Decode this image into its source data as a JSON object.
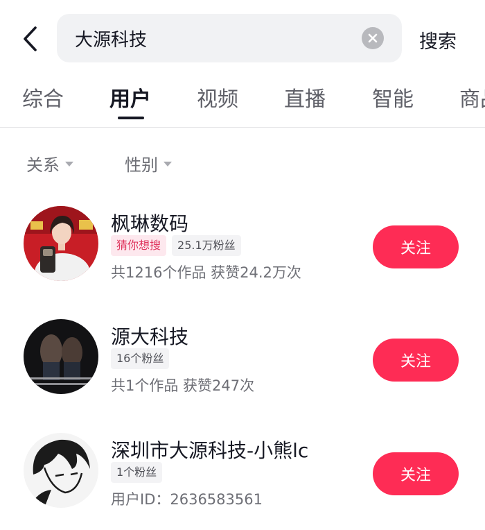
{
  "search": {
    "query": "大源科技",
    "button_label": "搜索"
  },
  "tabs": [
    {
      "label": "综合"
    },
    {
      "label": "用户"
    },
    {
      "label": "视频"
    },
    {
      "label": "直播"
    },
    {
      "label": "智能"
    },
    {
      "label": "商品"
    }
  ],
  "active_tab": "用户",
  "filters": [
    {
      "label": "关系"
    },
    {
      "label": "性别"
    }
  ],
  "users": [
    {
      "name": "枫琳数码",
      "tags": [
        {
          "label": "猜你想搜"
        },
        {
          "label": "25.1万粉丝"
        }
      ],
      "meta": "共1216个作品 获赞24.2万次",
      "follow_label": "关注"
    },
    {
      "name": "源大科技",
      "tags": [
        {
          "label": "16个粉丝"
        }
      ],
      "meta": "共1个作品 获赞247次",
      "follow_label": "关注"
    },
    {
      "name": "深圳市大源科技-小熊lc",
      "tags": [
        {
          "label": "1个粉丝"
        }
      ],
      "meta": "用户ID：2636583561",
      "follow_label": "关注"
    }
  ],
  "colors": {
    "accent": "#fe2c55",
    "text_primary": "#161823",
    "text_secondary": "#6e6f76",
    "tag_pink_text": "#e0365f"
  },
  "icons": {
    "back": "chevron-left-icon",
    "clear": "clear-x-icon",
    "filter_caret": "caret-down-icon"
  }
}
